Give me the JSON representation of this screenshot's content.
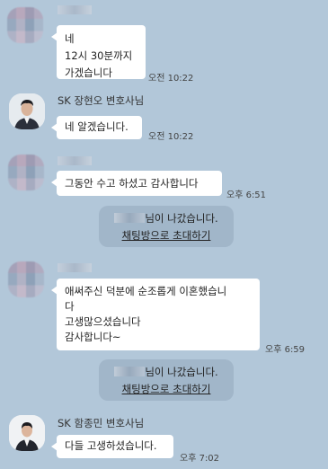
{
  "messages": [
    {
      "sender": "",
      "lines": "네\n12시 30분까지\n가겠습니다",
      "time": "오전 10:22"
    },
    {
      "sender": "SK 장현오 변호사님",
      "lines": "네 알겠습니다.",
      "time": "오전 10:22"
    },
    {
      "sender": "",
      "lines": "그동안 수고 하셨고 감사합니다",
      "time": "오후 6:51"
    },
    {
      "sender": "",
      "lines": "애써주신 덕분에 순조롭게 이혼했습니\n다\n고생많으셨습니다\n감사합니다~",
      "time": "오후 6:59"
    },
    {
      "sender": "SK 함종민 변호사님",
      "lines": "다들 고생하셨습니다.",
      "time": "오후 7:02"
    }
  ],
  "notices": [
    {
      "text": "님이 나갔습니다.",
      "link": "채팅방으로 초대하기"
    },
    {
      "text": "님이 나갔습니다.",
      "link": "채팅방으로 초대하기"
    }
  ]
}
